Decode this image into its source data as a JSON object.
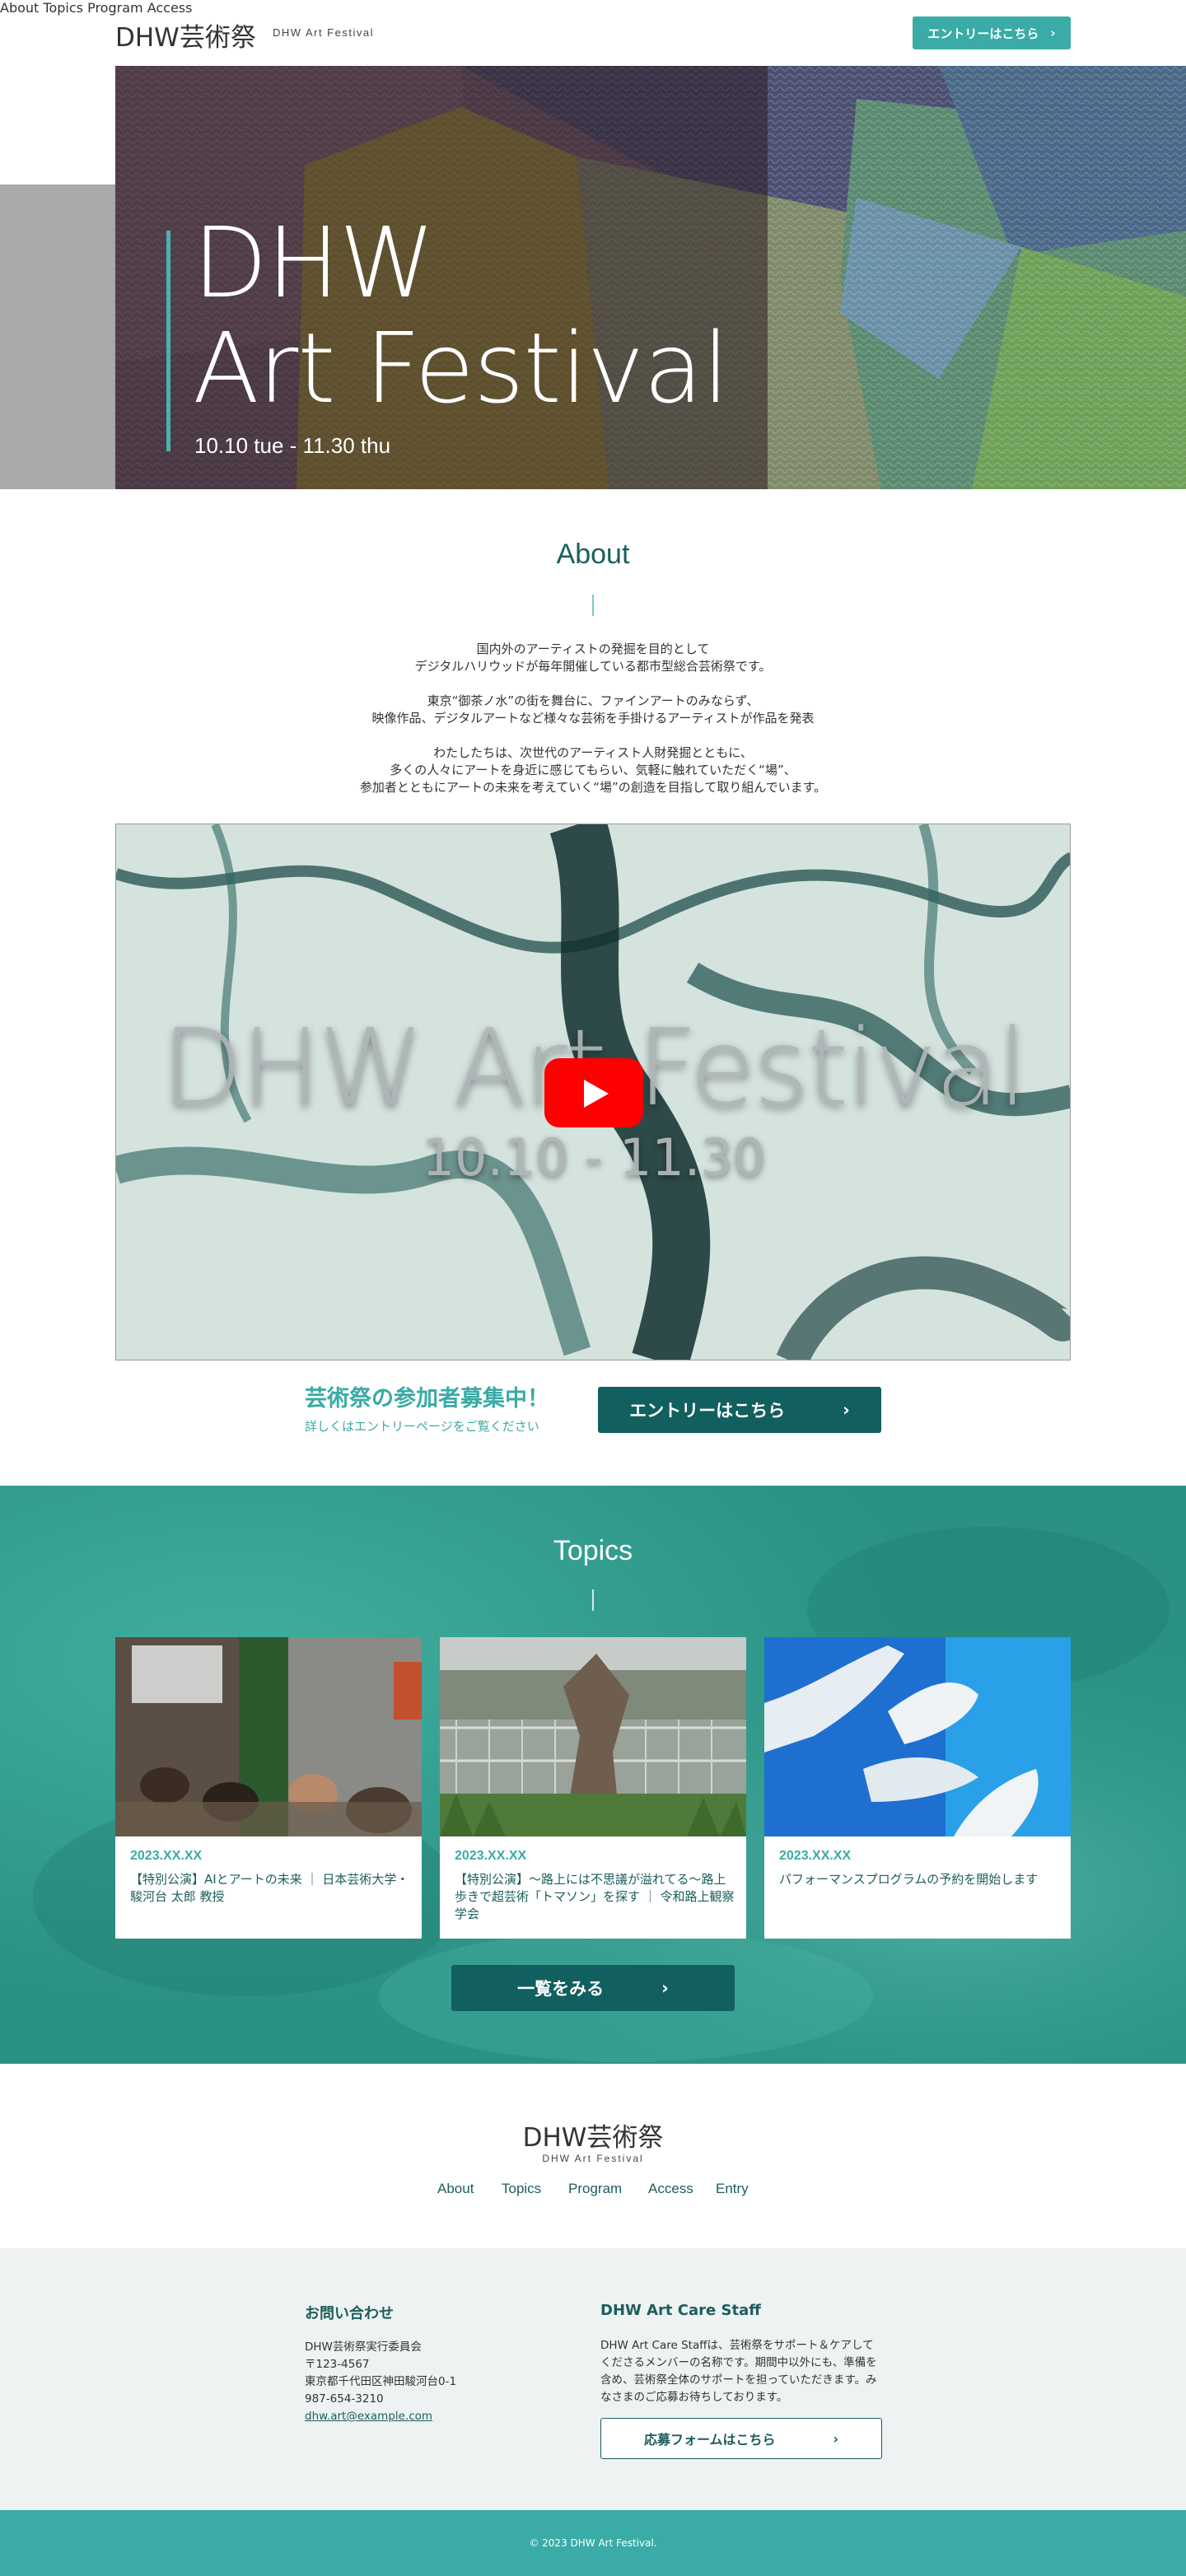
{
  "header": {
    "logo": "DHW芸術祭",
    "logo_sub": "DHW Art Festival",
    "nav": [
      "About",
      "Topics",
      "Program",
      "Access"
    ],
    "cta_label": "エントリーはこちら",
    "cta_arrow": "›"
  },
  "hero": {
    "title_line1": "DHW",
    "title_line2": "Art Festival",
    "date": "10.10 tue - 11.30 thu"
  },
  "about": {
    "title": "About",
    "paragraphs": [
      [
        "国内外のアーティストの発掘を目的として",
        "デジタルハリウッドが毎年開催している都市型総合芸術祭です。"
      ],
      [
        "東京“御茶ノ水”の街を舞台に、ファインアートのみならず、",
        "映像作品、デジタルアートなど様々な芸術を手掛けるアーティストが作品を発表"
      ],
      [
        "わたしたちは、次世代のアーティスト人財発掘とともに、",
        "多くの人々にアートを身近に感じてもらい、気軽に触れていただく“場”、",
        "参加者とともにアートの未来を考えていく“場”の創造を目指して取り組んでいます。"
      ]
    ],
    "video": {
      "title": "DHW Art Festival",
      "date": "10.10 - 11.30"
    },
    "recruit_title": "芸術祭の参加者募集中！",
    "recruit_sub": "詳しくはエントリーページをご覧ください",
    "recruit_button": "エントリーはこちら",
    "recruit_arrow": "›"
  },
  "topics": {
    "title": "Topics",
    "cards": [
      {
        "date": "2023.XX.XX",
        "text": "【特別公演】AIとアートの未来 ｜ 日本芸術大学・駿河台 太郎 教授"
      },
      {
        "date": "2023.XX.XX",
        "text": "【特別公演】〜路上には不思議が溢れてる〜路上歩きで超芸術「トマソン」を探す ｜ 令和路上観察学会"
      },
      {
        "date": "2023.XX.XX",
        "text": "パフォーマンスプログラムの予約を開始します"
      }
    ],
    "more_button": "一覧をみる",
    "more_arrow": "›"
  },
  "footer": {
    "logo": "DHW芸術祭",
    "logo_sub": "DHW Art Festival",
    "nav": [
      "About",
      "Topics",
      "Program",
      "Access",
      "Entry"
    ],
    "contact_title": "お問い合わせ",
    "contact_lines": [
      "DHW芸術祭実行委員会",
      "〒123-4567",
      "東京都千代田区神田駿河台0-1",
      "987-654-3210"
    ],
    "contact_email": "dhw.art@example.com",
    "staff_title": "DHW Art Care Staff",
    "staff_desc": "DHW Art Care Staffは、芸術祭をサポート＆ケアしてくださるメンバーの名称です。期間中以外にも、準備を含め、芸術祭全体のサポートを担っていただきます。みなさまのご応募お待ちしております。",
    "staff_button": "応募フォームはこちら",
    "staff_arrow": "›",
    "copyright": "© 2023 DHW Art Festival."
  },
  "colors": {
    "accent": "#3aaba6",
    "dark_teal": "#115f5e",
    "text_teal": "#1b5e5c"
  }
}
